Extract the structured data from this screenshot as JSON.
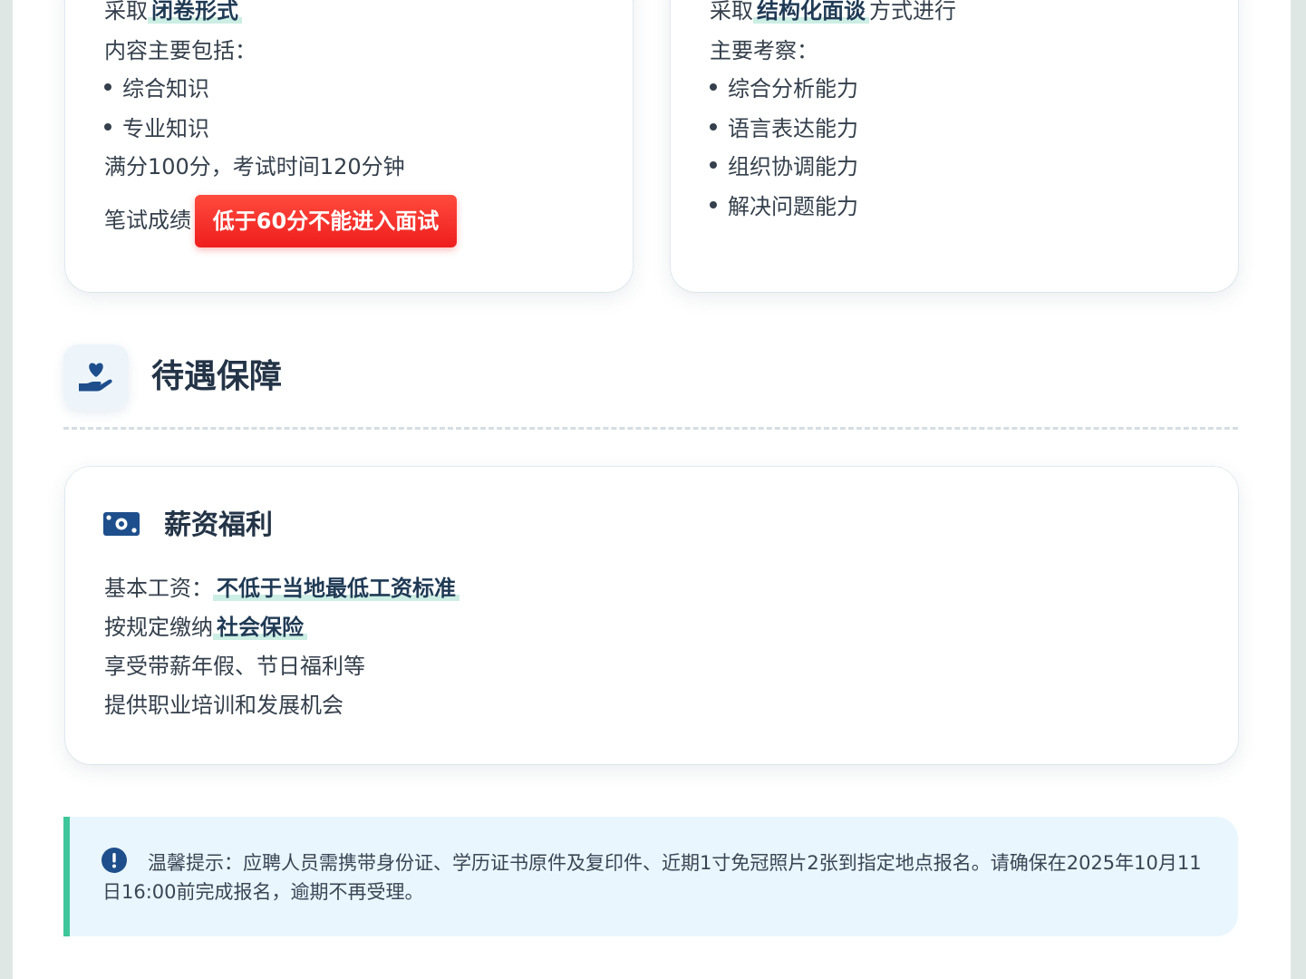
{
  "written_exam": {
    "format_prefix": "采取",
    "format_highlight": "闭卷形式",
    "content_intro": "内容主要包括：",
    "items": [
      "综合知识",
      "专业知识"
    ],
    "score_time": "满分100分，考试时间120分钟",
    "score_label": "笔试成绩",
    "score_warning": "低于60分不能进入面试"
  },
  "interview": {
    "format_prefix": "采取",
    "format_highlight": "结构化面谈",
    "format_suffix": "方式进行",
    "focus_intro": "主要考察：",
    "items": [
      "综合分析能力",
      "语言表达能力",
      "组织协调能力",
      "解决问题能力"
    ]
  },
  "benefits_section": {
    "title": "待遇保障",
    "icon": "hand-heart-icon"
  },
  "salary_card": {
    "title": "薪资福利",
    "icon": "money-bill-icon",
    "basic_label": "基本工资：",
    "basic_value": "不低于当地最低工资标准",
    "insurance_prefix": "按规定缴纳",
    "insurance_value": "社会保险",
    "vacation": "享受带薪年假、节日福利等",
    "training": "提供职业培训和发展机会"
  },
  "notice": {
    "icon": "exclamation-circle-icon",
    "text": "温馨提示：应聘人员需携带身份证、学历证书原件及复印件、近期1寸免冠照片2张到指定地点报名。请确保在2025年10月11日16:00前完成报名，逾期不再受理。"
  },
  "colors": {
    "accent_green": "#3ec79a",
    "warning_red": "#ee1d1d",
    "icon_blue": "#1e4f8c",
    "notice_bg": "#e9f6fd"
  }
}
